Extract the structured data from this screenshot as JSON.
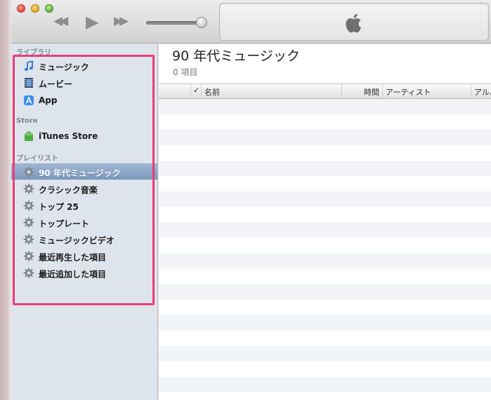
{
  "toolbar": {
    "lcd_logo": "apple-icon"
  },
  "sidebar": {
    "sections": [
      {
        "heading": "ライブラリ",
        "items": [
          {
            "label": "ミュージック",
            "icon": "music-note-icon"
          },
          {
            "label": "ムービー",
            "icon": "film-icon"
          },
          {
            "label": "App",
            "icon": "app-store-icon"
          }
        ]
      },
      {
        "heading": "Store",
        "items": [
          {
            "label": "iTunes Store",
            "icon": "store-bag-icon"
          }
        ]
      },
      {
        "heading": "プレイリスト",
        "items": [
          {
            "label": "90 年代ミュージック",
            "icon": "smart-playlist-gear-icon",
            "selected": true
          },
          {
            "label": "クラシック音楽",
            "icon": "smart-playlist-gear-icon"
          },
          {
            "label": "トップ 25",
            "icon": "smart-playlist-gear-icon"
          },
          {
            "label": "トップレート",
            "icon": "smart-playlist-gear-icon"
          },
          {
            "label": "ミュージックビデオ",
            "icon": "smart-playlist-gear-icon"
          },
          {
            "label": "最近再生した項目",
            "icon": "smart-playlist-gear-icon"
          },
          {
            "label": "最近追加した項目",
            "icon": "smart-playlist-gear-icon"
          }
        ]
      }
    ]
  },
  "main": {
    "title": "90 年代ミュージック",
    "count": "0 項目",
    "columns": {
      "check": "✓",
      "name": "名前",
      "time": "時間",
      "artist": "アーティスト",
      "album": "アルバム"
    }
  },
  "colors": {
    "highlight_box": "#ec3c77",
    "selected_row": "#7a98bd"
  }
}
